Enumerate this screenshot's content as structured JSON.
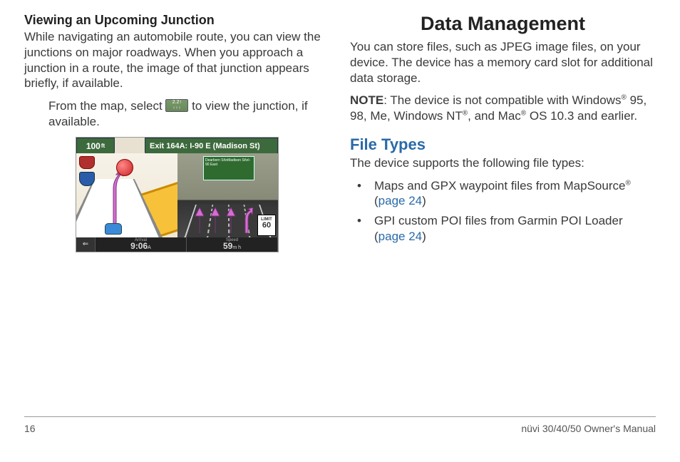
{
  "left": {
    "heading": "Viewing an Upcoming Junction",
    "para1": "While navigating an automobile route, you can view the junctions on major roadways. When you approach a junction in a route, the image of that junction appears briefly, if available.",
    "instr_a": "From the map, select ",
    "instr_b": " to view the junction, if available.",
    "screenshot": {
      "distance": "100",
      "exit_label": "Exit 164A: I-90 E (Madison St)",
      "sign_text": "Dearborn St\\nMadison St\\nI-90 East",
      "arrival_label": "Arrival",
      "arrival_value": "9:06",
      "arrival_suffix": "A",
      "speed_label": "Speed",
      "speed_value": "59",
      "speed_suffix": "m h",
      "limit_label": "LIMIT",
      "limit_value": "60"
    }
  },
  "right": {
    "chapter": "Data Management",
    "para1": "You can store files, such as JPEG image files, on your device. The device has a memory card slot for additional data storage.",
    "note_label": "NOTE",
    "note_a": ": The device is not compatible with Windows",
    "note_b": " 95, 98, Me, Windows NT",
    "note_c": ", and Mac",
    "note_d": " OS 10.3 and earlier.",
    "sub_heading": "File Types",
    "para2": "The device supports the following file types:",
    "bullet1_a": "Maps and GPX waypoint files from MapSource",
    "bullet1_b": " (",
    "bullet1_link": "page 24",
    "bullet1_c": ")",
    "bullet2_a": "GPI custom POI files from Garmin POI Loader (",
    "bullet2_link": "page 24",
    "bullet2_b": ")",
    "reg": "®"
  },
  "footer": {
    "page_num": "16",
    "manual": "nüvi 30/40/50 Owner's Manual"
  }
}
